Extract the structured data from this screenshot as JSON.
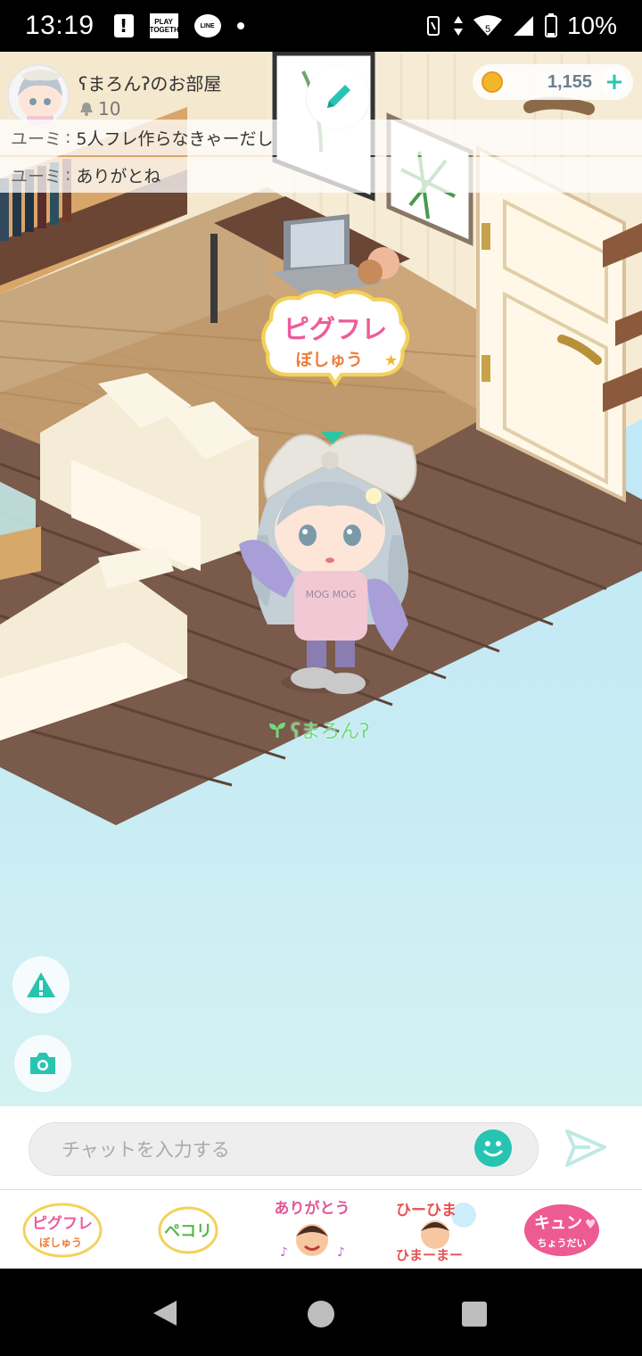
{
  "status_bar": {
    "time": "13:19",
    "play_icon_text": "PLAY TOGETHER",
    "line_icon_text": "LINE",
    "battery": "10%",
    "signal_badge": "5"
  },
  "room": {
    "title": "ʕまろんʔのお部屋",
    "bell_count": "10"
  },
  "currency": {
    "amount": "1,155",
    "plus_label": "+"
  },
  "chat_log": [
    {
      "user": "ユーミ",
      "message": "5人フレ作らなきゃーだし"
    },
    {
      "user": "ユーミ",
      "message": "ありがとね"
    }
  ],
  "speech_bubble": {
    "line1": "ピグフレ",
    "line2": "ぼしゅう"
  },
  "player": {
    "name": "ʕまろんʔ",
    "shirt_text": "MOG MOG"
  },
  "input": {
    "placeholder": "チャットを入力する"
  },
  "stamps": [
    {
      "name": "pigufure-boshuu",
      "line1": "ピグフレ",
      "line2": "ぼしゅう"
    },
    {
      "name": "pekori",
      "line1": "ペコリ",
      "line2": ""
    },
    {
      "name": "arigatou",
      "line1": "ありがとう",
      "line2": ""
    },
    {
      "name": "himahima",
      "line1": "ひーひま",
      "line2": "ひまーまー"
    },
    {
      "name": "kyun",
      "line1": "キュン",
      "line2": "ちょうだい"
    }
  ],
  "colors": {
    "accent": "#27c5b1",
    "floor": "#7a5a4a",
    "sky": "#bde6f6"
  },
  "icons": [
    "warning-icon",
    "camera-icon",
    "pencil-icon",
    "emoji-icon",
    "send-icon",
    "bell-icon",
    "coin-icon"
  ]
}
